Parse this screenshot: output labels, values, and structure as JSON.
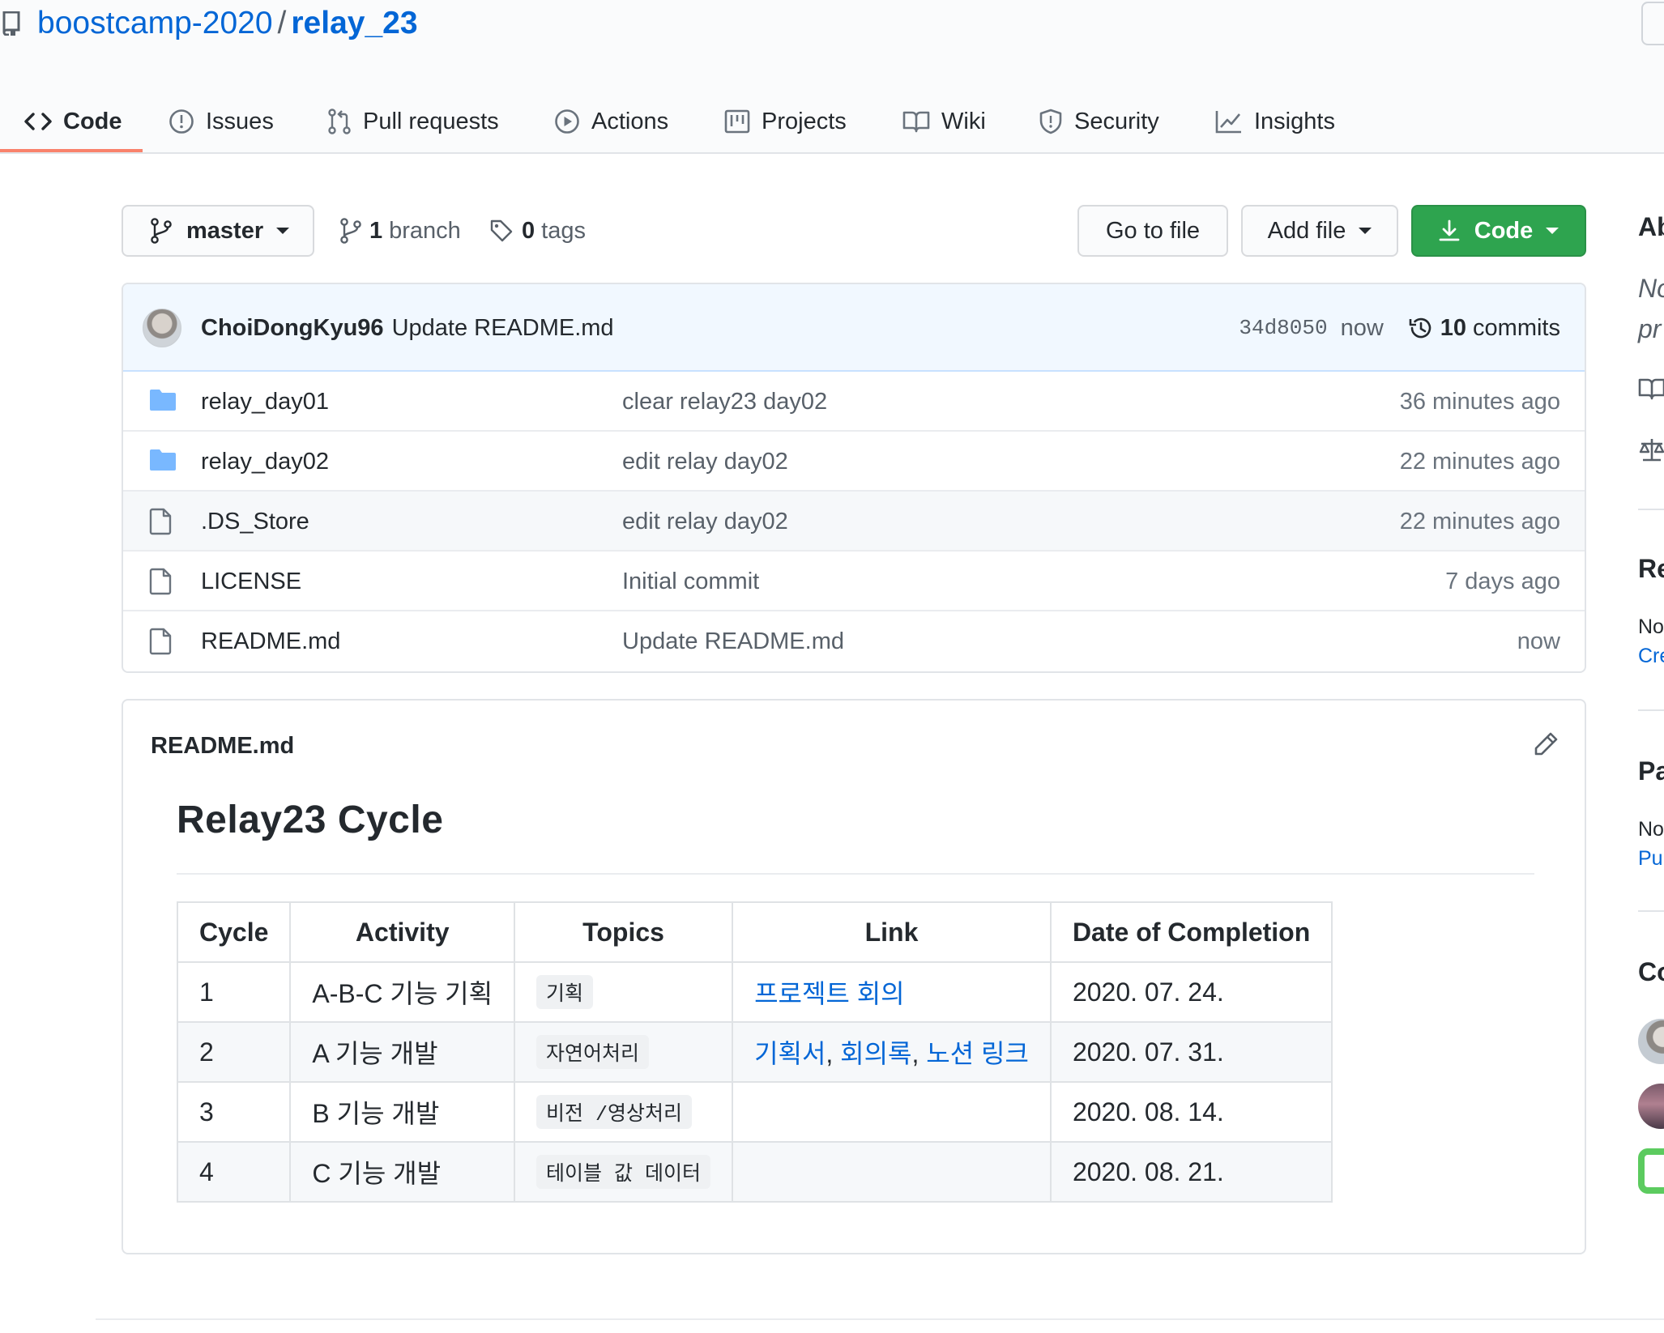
{
  "header": {
    "owner": "boostcamp-2020",
    "separator": "/",
    "repo": "relay_23"
  },
  "tabs": [
    {
      "label": "Code",
      "icon": "code-icon",
      "selected": true
    },
    {
      "label": "Issues",
      "icon": "issue-icon"
    },
    {
      "label": "Pull requests",
      "icon": "pull-request-icon"
    },
    {
      "label": "Actions",
      "icon": "play-icon"
    },
    {
      "label": "Projects",
      "icon": "project-icon"
    },
    {
      "label": "Wiki",
      "icon": "book-icon"
    },
    {
      "label": "Security",
      "icon": "shield-icon"
    },
    {
      "label": "Insights",
      "icon": "graph-icon"
    }
  ],
  "branch_bar": {
    "current_branch": "master",
    "branch_count": "1",
    "branch_label": "branch",
    "tag_count": "0",
    "tag_label": "tags",
    "go_to_file": "Go to file",
    "add_file": "Add file",
    "code": "Code"
  },
  "latest_commit": {
    "author": "ChoiDongKyu96",
    "message": "Update README.md",
    "sha": "34d8050",
    "time": "now",
    "commit_count": "10",
    "commit_label": "commits"
  },
  "files": [
    {
      "type": "folder",
      "name": "relay_day01",
      "message": "clear relay23 day02",
      "age": "36 minutes ago"
    },
    {
      "type": "folder",
      "name": "relay_day02",
      "message": "edit relay day02",
      "age": "22 minutes ago"
    },
    {
      "type": "file",
      "name": ".DS_Store",
      "message": "edit relay day02",
      "age": "22 minutes ago"
    },
    {
      "type": "file",
      "name": "LICENSE",
      "message": "Initial commit",
      "age": "7 days ago"
    },
    {
      "type": "file",
      "name": "README.md",
      "message": "Update README.md",
      "age": "now"
    }
  ],
  "readme": {
    "file_name": "README.md",
    "heading": "Relay23 Cycle",
    "table": {
      "headers": [
        "Cycle",
        "Activity",
        "Topics",
        "Link",
        "Date of Completion"
      ],
      "rows": [
        {
          "cycle": "1",
          "activity": "A-B-C 기능 기획",
          "topic": "기획",
          "links": [
            "프로젝트 회의"
          ],
          "date": "2020. 07. 24."
        },
        {
          "cycle": "2",
          "activity": "A 기능 개발",
          "topic": "자연어처리",
          "links": [
            "기획서",
            "회의록",
            "노션 링크"
          ],
          "date": "2020. 07. 31."
        },
        {
          "cycle": "3",
          "activity": "B 기능 개발",
          "topic": "비전 /영상처리",
          "links": [],
          "date": "2020. 08. 14."
        },
        {
          "cycle": "4",
          "activity": "C 기능 개발",
          "topic": "테이블 값 데이터",
          "links": [],
          "date": "2020. 08. 21."
        }
      ],
      "link_separator": ", "
    }
  },
  "sidebar": {
    "about_heading": "Ab",
    "about_desc_1": "No",
    "about_desc_2": "pr",
    "releases_heading": "Re",
    "releases_text": "No",
    "releases_link": "Cre",
    "packages_heading": "Pa",
    "packages_text": "No",
    "packages_link": "Pul",
    "contributors_heading": "Co"
  },
  "colors": {
    "link": "#0366d6",
    "primary_button": "#2ea44f",
    "tab_underline": "#f9826c",
    "folder": "#79b8ff"
  }
}
